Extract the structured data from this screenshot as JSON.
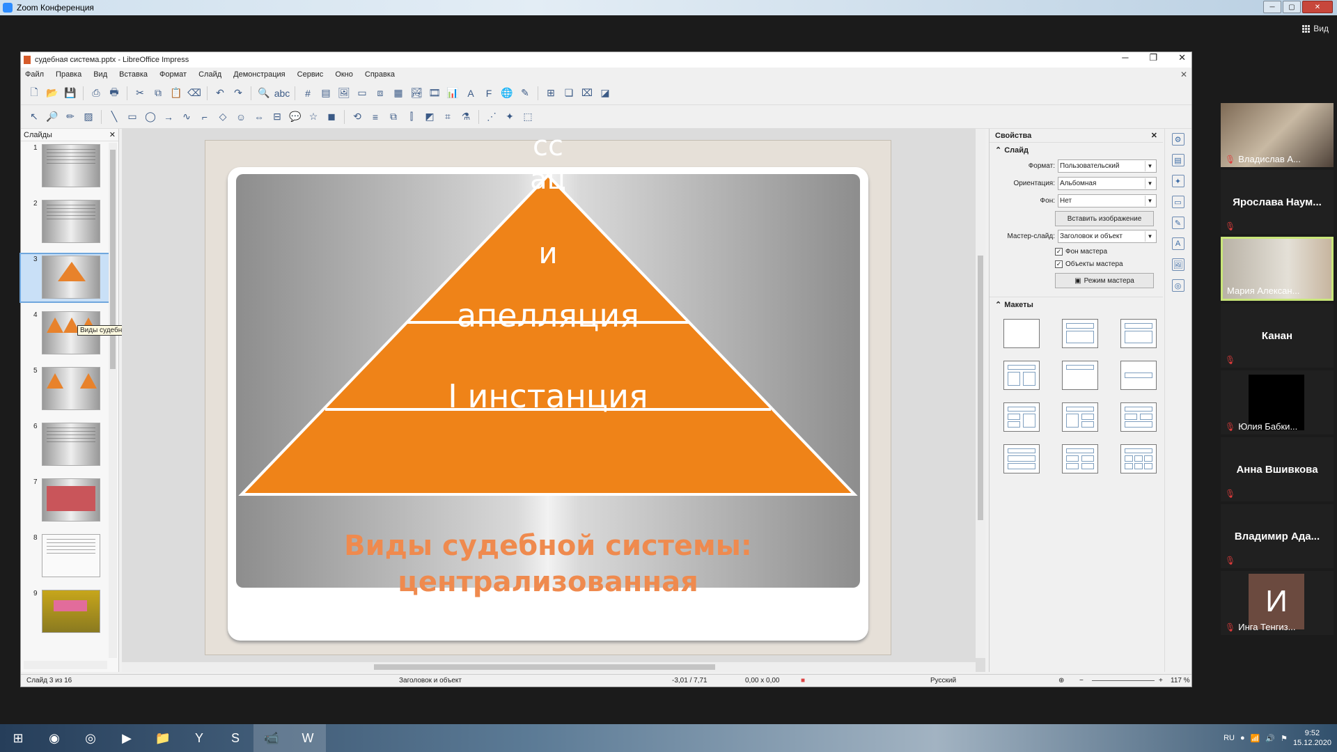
{
  "zoom": {
    "window_title": "Zoom Конференция",
    "view_button": "Вид"
  },
  "lo": {
    "title": "судебная система.pptx - LibreOffice Impress",
    "menu": [
      "Файл",
      "Правка",
      "Вид",
      "Вставка",
      "Формат",
      "Слайд",
      "Демонстрация",
      "Сервис",
      "Окно",
      "Справка"
    ],
    "slides_panel_title": "Слайды",
    "tooltip": "Виды судебной системы: централизованная",
    "slide_numbers": [
      "1",
      "2",
      "3",
      "4",
      "5",
      "6",
      "7",
      "8",
      "9"
    ],
    "slide": {
      "top_text_1": "сс",
      "top_text_2": "ац",
      "level_top": "и",
      "level_mid": "апелляция",
      "level_bottom": "I инстанция",
      "caption_1": "Виды судебной системы:",
      "caption_2": "централизованная"
    },
    "sidebar": {
      "title": "Свойства",
      "section_slide": "Слайд",
      "format_label": "Формат:",
      "format_value": "Пользовательский",
      "orientation_label": "Ориентация:",
      "orientation_value": "Альбомная",
      "background_label": "Фон:",
      "background_value": "Нет",
      "insert_image": "Вставить изображение",
      "master_label": "Мастер-слайд:",
      "master_value": "Заголовок и объект",
      "master_bg": "Фон мастера",
      "master_objects": "Объекты мастера",
      "master_mode": "Режим мастера",
      "section_layouts": "Макеты"
    },
    "status": {
      "slide_of": "Слайд 3 из 16",
      "layout": "Заголовок и объект",
      "position": "-3,01 / 7,71",
      "size": "0,00 x 0,00",
      "language": "Русский",
      "zoom": "117 %"
    }
  },
  "participants": [
    {
      "name": "Владислав А...",
      "video": true
    },
    {
      "name": "Ярослава  Наум...",
      "video": false
    },
    {
      "name": "Мария Алексан...",
      "video": true
    },
    {
      "name": "Канан",
      "video": false
    },
    {
      "name": "Юлия Бабки...",
      "video": false
    },
    {
      "name": "Анна Вшивкова",
      "video": false
    },
    {
      "name": "Владимир  Ада...",
      "video": false
    },
    {
      "name": "Инга Тенгиз...",
      "video": false,
      "avatar": "И"
    }
  ],
  "taskbar": {
    "lang": "RU",
    "time": "9:52",
    "date": "15.12.2020"
  },
  "colors": {
    "pyramid_orange": "#ef8318",
    "caption_orange": "#ef8a4e",
    "active_speaker_border": "#c9e67a",
    "mute_red": "#e03b3b"
  }
}
